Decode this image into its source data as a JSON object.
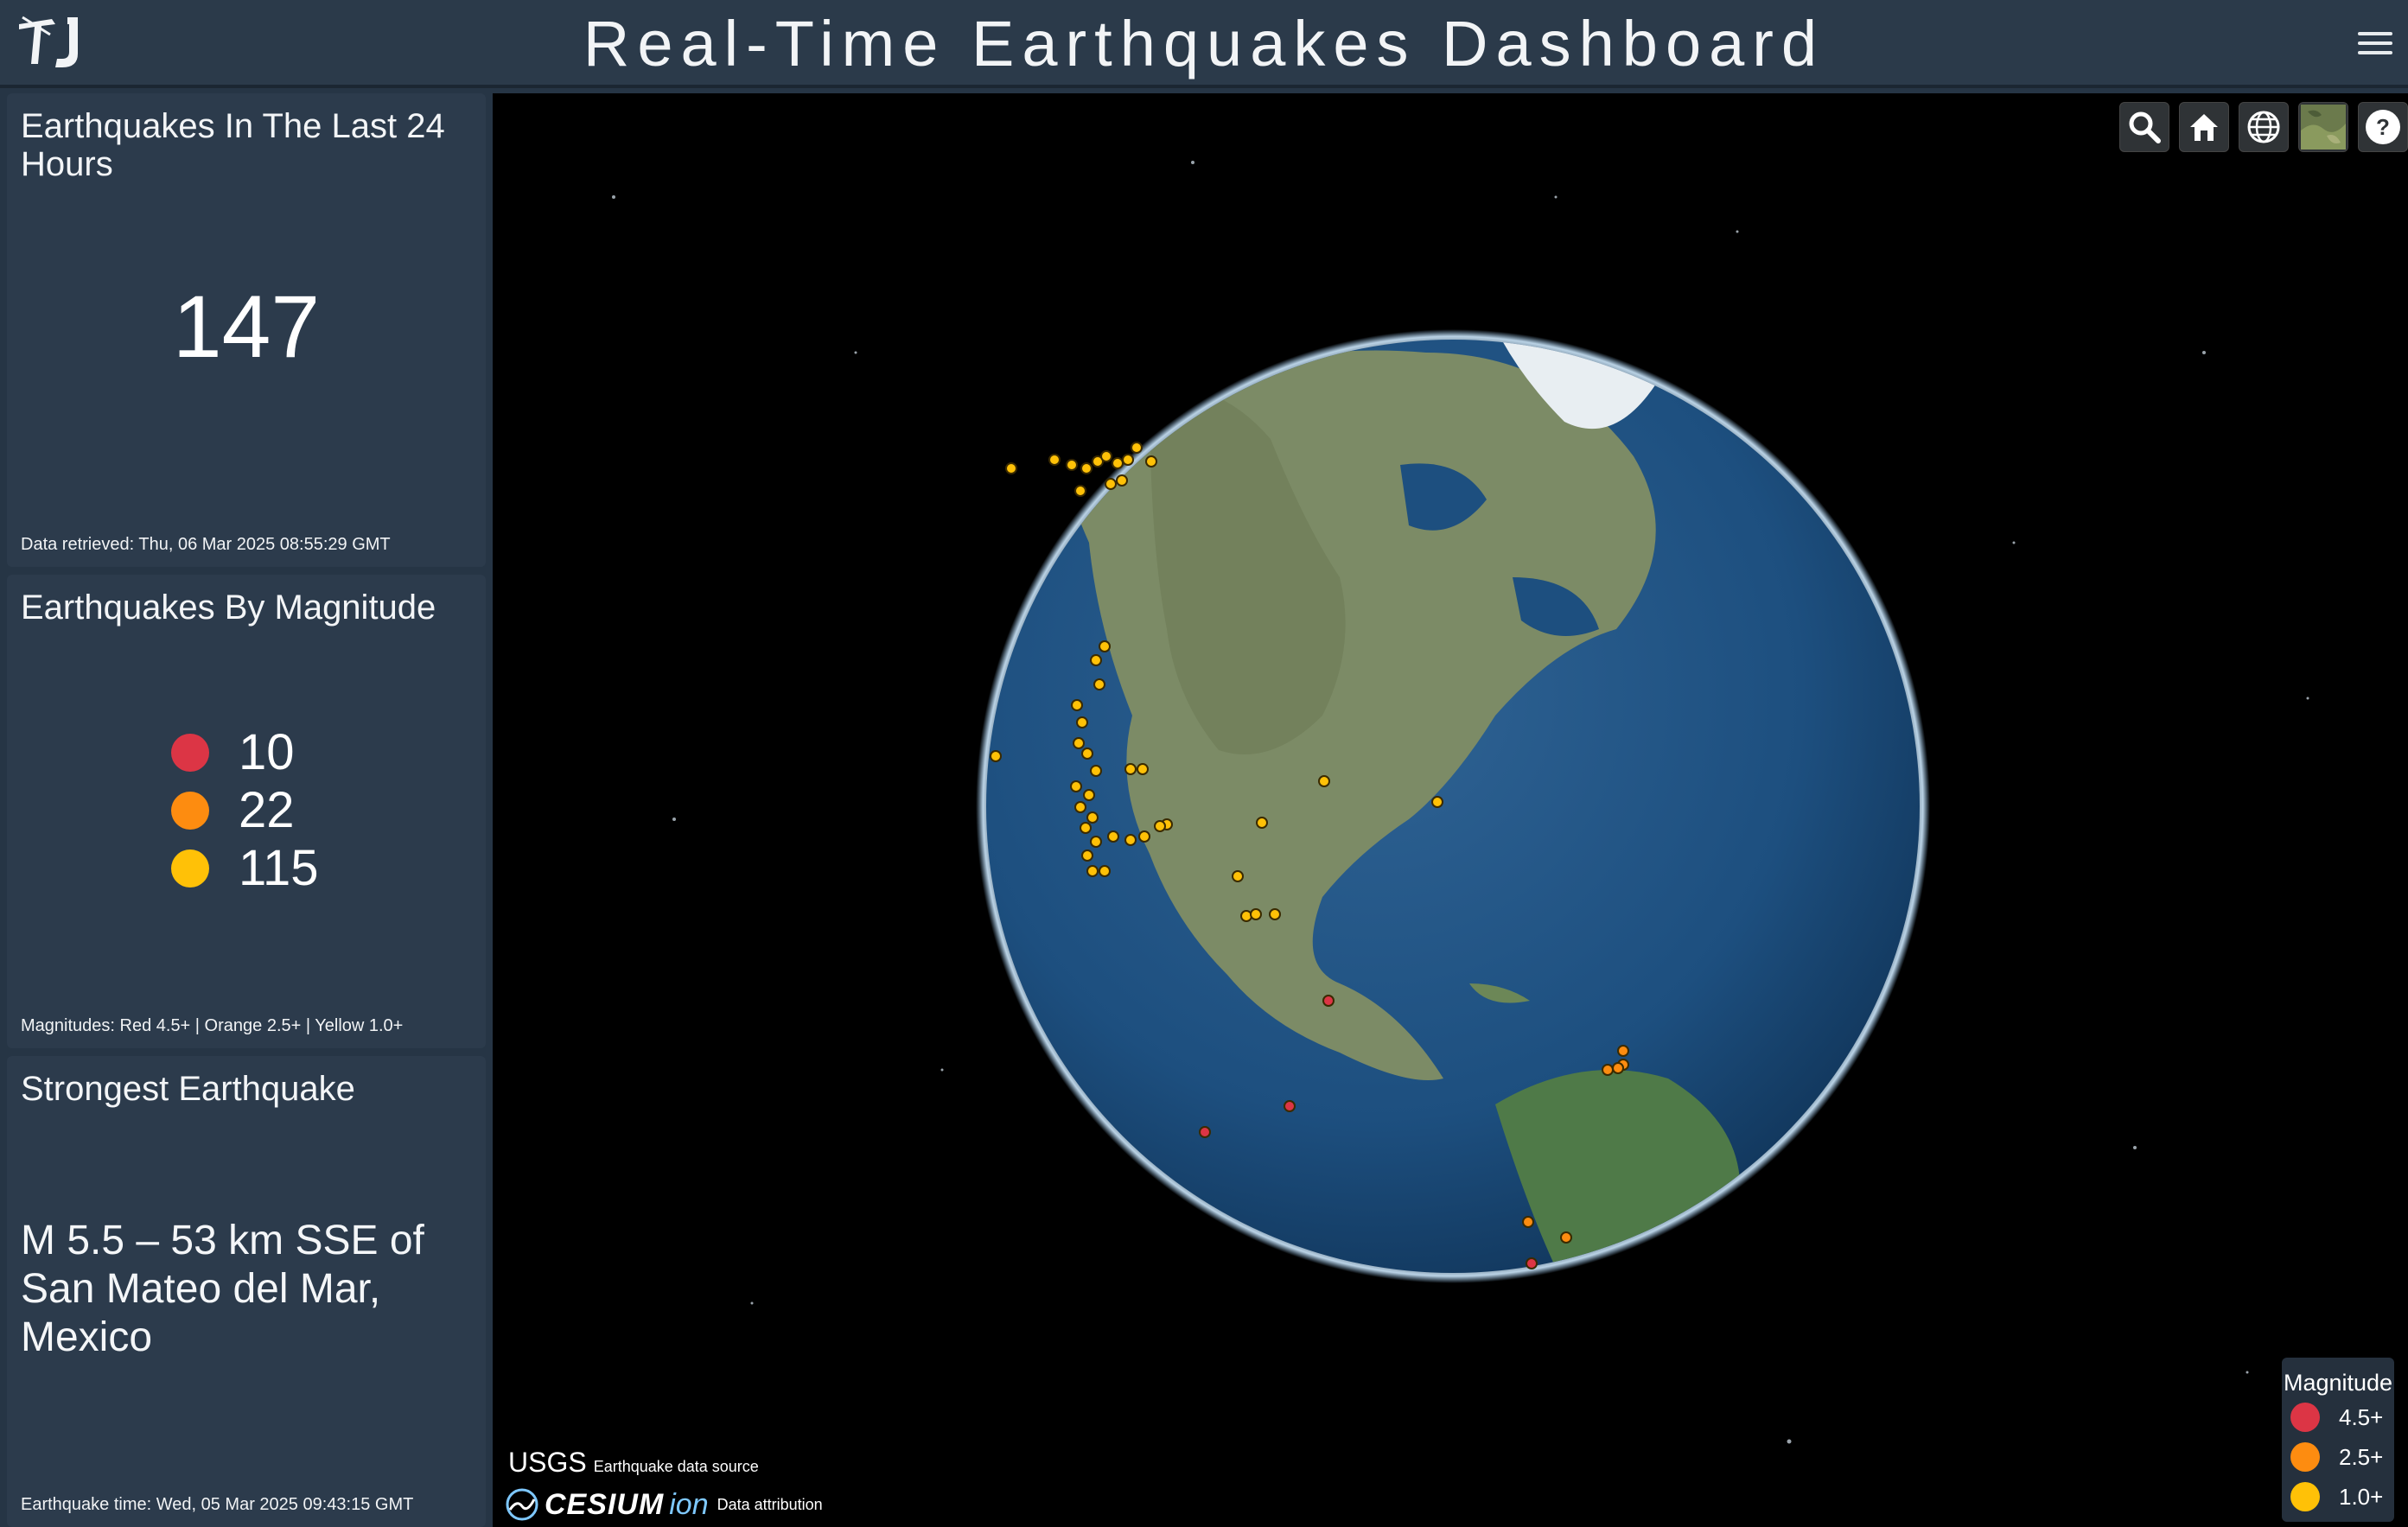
{
  "header": {
    "title": "Real-Time Earthquakes Dashboard",
    "logo_icon": "tj-logo-icon",
    "menu_icon": "hamburger-menu-icon"
  },
  "panels": {
    "count": {
      "title": "Earthquakes In The Last 24 Hours",
      "value": "147",
      "footer": "Data retrieved: Thu, 06 Mar 2025 08:55:29 GMT"
    },
    "magnitude": {
      "title": "Earthquakes By Magnitude",
      "rows": [
        {
          "color": "#dc3545",
          "count": "10"
        },
        {
          "color": "#fd8c10",
          "count": "22"
        },
        {
          "color": "#ffc107",
          "count": "115"
        }
      ],
      "footer": "Magnitudes: Red 4.5+ | Orange 2.5+ | Yellow 1.0+"
    },
    "strongest": {
      "title": "Strongest Earthquake",
      "name": "M 5.5 – 53 km SSE of San Mateo del Mar, Mexico",
      "footer": "Earthquake time: Wed, 05 Mar 2025 09:43:15 GMT"
    }
  },
  "viewer": {
    "toolbar": [
      "search-icon",
      "home-icon",
      "globe-icon",
      "imagery-icon",
      "help-icon"
    ],
    "legend": {
      "title": "Magnitude",
      "items": [
        {
          "label": "4.5+",
          "color": "#dc3545"
        },
        {
          "label": "2.5+",
          "color": "#fd8c10"
        },
        {
          "label": "1.0+",
          "color": "#ffc107"
        }
      ]
    },
    "credits": {
      "usgs": "USGS",
      "usgs_note": "Earthquake data source",
      "cesium": "CESIUM",
      "ion": "ion",
      "cesium_note": "Data attribution"
    }
  }
}
